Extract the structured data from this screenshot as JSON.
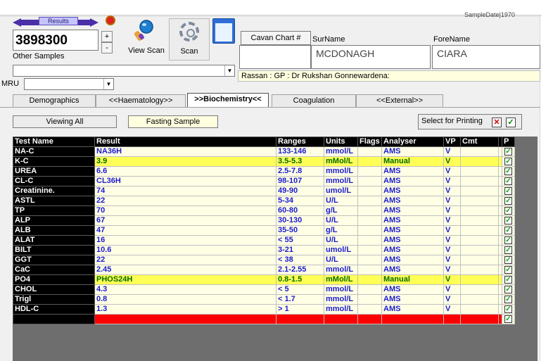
{
  "header": {
    "sample_date": "SampleDate|1970",
    "results_label": "Results",
    "sample_number": "3898300",
    "spin_up": "+",
    "spin_down": "-",
    "other_samples": "Other Samples",
    "view_scan": "View Scan",
    "scan": "Scan",
    "mru_label": "MRU",
    "combo_value": "",
    "mru_value": ""
  },
  "patient": {
    "cavan_chart_label": "Cavan Chart #",
    "cavan_chart_value": "",
    "surname_label": "SurName",
    "surname": "MCDONAGH",
    "forename_label": "ForeName",
    "forename": "CIARA",
    "gp_info": "Rassan : GP : Dr Rukshan Gonnewardena:"
  },
  "tabs": [
    {
      "label": "Demographics"
    },
    {
      "label": "<<Haematology>>"
    },
    {
      "label": ">>Biochemistry<<"
    },
    {
      "label": "Coagulation"
    },
    {
      "label": "<<External>>"
    }
  ],
  "filters": {
    "viewing": "Viewing All",
    "fasting": "Fasting Sample",
    "select_printing": "Select for Printing",
    "chk_x": "✕",
    "chk_ok": "✓"
  },
  "grid": {
    "headers": [
      "Test Name",
      "Result",
      "Ranges",
      "Units",
      "Flags",
      "Analyser",
      "VP",
      "Cmt",
      "",
      "P"
    ],
    "rows": [
      {
        "name": "NA-C",
        "result": "NA36H",
        "range": "133-146",
        "units": "mmol/L",
        "flags": "",
        "analyser": "AMS",
        "vp": "V",
        "cmt": "",
        "p": "✓"
      },
      {
        "name": "K-C",
        "result": "3.9",
        "range": "3.5-5.3",
        "units": "mMol/L",
        "flags": "",
        "analyser": "Manual",
        "vp": "V",
        "cmt": "",
        "p": "✓"
      },
      {
        "name": "UREA",
        "result": "6.6",
        "range": "2.5-7.8",
        "units": "mmol/L",
        "flags": "",
        "analyser": "AMS",
        "vp": "V",
        "cmt": "",
        "p": "✓"
      },
      {
        "name": "CL-C",
        "result": "CL36H",
        "range": "98-107",
        "units": "mmol/L",
        "flags": "",
        "analyser": "AMS",
        "vp": "V",
        "cmt": "",
        "p": "✓"
      },
      {
        "name": "Creatinine.",
        "result": "74",
        "range": "49-90",
        "units": "umol/L",
        "flags": "",
        "analyser": "AMS",
        "vp": "V",
        "cmt": "",
        "p": "✓"
      },
      {
        "name": "ASTL",
        "result": "22",
        "range": "5-34",
        "units": "U/L",
        "flags": "",
        "analyser": "AMS",
        "vp": "V",
        "cmt": "",
        "p": "✓"
      },
      {
        "name": "TP",
        "result": "70",
        "range": "60-80",
        "units": "g/L",
        "flags": "",
        "analyser": "AMS",
        "vp": "V",
        "cmt": "",
        "p": "✓"
      },
      {
        "name": "ALP",
        "result": "67",
        "range": "30-130",
        "units": "U/L",
        "flags": "",
        "analyser": "AMS",
        "vp": "V",
        "cmt": "",
        "p": "✓"
      },
      {
        "name": "ALB",
        "result": "47",
        "range": "35-50",
        "units": "g/L",
        "flags": "",
        "analyser": "AMS",
        "vp": "V",
        "cmt": "",
        "p": "✓"
      },
      {
        "name": "ALAT",
        "result": "16",
        "range": "< 55",
        "units": "U/L",
        "flags": "",
        "analyser": "AMS",
        "vp": "V",
        "cmt": "",
        "p": "✓"
      },
      {
        "name": "BILT",
        "result": "10.6",
        "range": "3-21",
        "units": "umol/L",
        "flags": "",
        "analyser": "AMS",
        "vp": "V",
        "cmt": "",
        "p": "✓"
      },
      {
        "name": "GGT",
        "result": "22",
        "range": "< 38",
        "units": "U/L",
        "flags": "",
        "analyser": "AMS",
        "vp": "V",
        "cmt": "",
        "p": "✓"
      },
      {
        "name": "CaC",
        "result": "2.45",
        "range": "2.1-2.55",
        "units": "mmol/L",
        "flags": "",
        "analyser": "AMS",
        "vp": "V",
        "cmt": "",
        "p": "✓"
      },
      {
        "name": "PO4",
        "result": "PHOS24H",
        "range": "0.8-1.5",
        "units": "mMol/L",
        "flags": "",
        "analyser": "Manual",
        "vp": "V",
        "cmt": "",
        "p": "✓"
      },
      {
        "name": "CHOL",
        "result": "4.3",
        "range": "< 5",
        "units": "mmol/L",
        "flags": "",
        "analyser": "AMS",
        "vp": "V",
        "cmt": "",
        "p": "✓"
      },
      {
        "name": "Trigl",
        "result": "0.8",
        "range": "< 1.7",
        "units": "mmol/L",
        "flags": "",
        "analyser": "AMS",
        "vp": "V",
        "cmt": "",
        "p": "✓"
      },
      {
        "name": "HDL-C",
        "result": "1.3",
        "range": "> 1",
        "units": "mmol/L",
        "flags": "",
        "analyser": "AMS",
        "vp": "V",
        "cmt": "",
        "p": "✓"
      },
      {
        "name": "",
        "result": "",
        "range": "",
        "units": "",
        "flags": "",
        "analyser": "",
        "vp": "",
        "cmt": "",
        "p": "✓"
      }
    ],
    "highlight_rows": [
      1,
      13
    ],
    "red_rows": [
      17
    ]
  }
}
